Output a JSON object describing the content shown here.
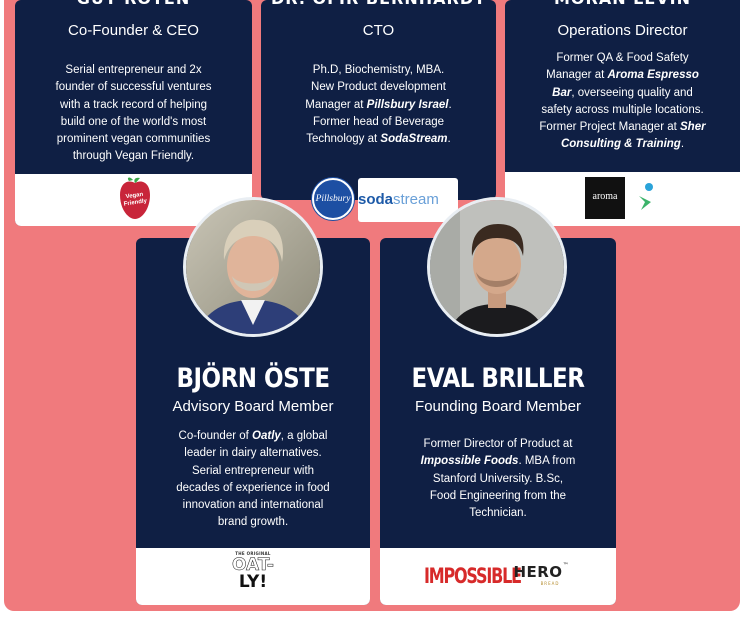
{
  "top_cards": [
    {
      "name": "GUY ROTEN",
      "role": "Co-Founder & CEO",
      "bio": [
        "Serial entrepreneur and 2x",
        "founder of successful ventures",
        "with a track record of helping",
        "build one of the world's most",
        "prominent vegan communities",
        "through Vegan Friendly."
      ],
      "logo": {
        "line1": "Vegan",
        "line2": "Friendly"
      }
    },
    {
      "name": "DR. OFIR BERNHARDT",
      "role": "CTO",
      "bio_plain1": "Ph.D, Biochemistry, MBA.",
      "bio_plain2": "New Product development",
      "bio_plain3": "Manager at ",
      "bio_em1": "Pillsbury Israel",
      "bio_plain4": ".",
      "bio_plain5": "Former head of Beverage",
      "bio_plain6": "Technology at ",
      "bio_em2": "SodaStream",
      "bio_plain7": ".",
      "logos": {
        "pillsbury": "Pillsbury",
        "soda": "soda",
        "stream": "stream"
      }
    },
    {
      "name": "MORAN LEVIN",
      "role": "Operations Director",
      "bio_l1": "Former QA & Food Safety",
      "bio_l2a": "Manager at ",
      "bio_l2b": "Aroma Espresso",
      "bio_l3a": "Bar",
      "bio_l3b": ", overseeing quality and",
      "bio_l4": "safety across multiple locations.",
      "bio_l5a": "Former Project Manager at ",
      "bio_l5b": "Sher",
      "bio_l6": "Consulting & Training",
      "bio_l6b": ".",
      "logos": {
        "aroma": "aroma"
      }
    }
  ],
  "bottom_cards": [
    {
      "name": "BJÖRN ÖSTE",
      "role": "Advisory Board Member",
      "bio_l1a": "Co-founder of ",
      "bio_l1b": "Oatly",
      "bio_l1c": ", a global",
      "bio_l2": "leader in dairy alternatives.",
      "bio_l3": "Serial entrepreneur with",
      "bio_l4": "decades of experience in food",
      "bio_l5": "innovation and international",
      "bio_l6": "brand growth.",
      "logo": {
        "top": "THE ORIGINAL",
        "mid": "OAT-",
        "bot": "LY!"
      }
    },
    {
      "name": "EVAL BRILLER",
      "role": "Founding Board Member",
      "bio_l1": "Former Director of Product at",
      "bio_l2a": "Impossible Foods",
      "bio_l2b": ". MBA from",
      "bio_l3": "Stanford University. B.Sc,",
      "bio_l4": "Food Engineering from the",
      "bio_l5": "Technician.",
      "logos": {
        "impossible": "IMPOSSIBLE",
        "hero": "HERO",
        "hero_tm": "™",
        "hero_sub": "BREAD"
      }
    }
  ],
  "colors": {
    "background": "#f07a7d",
    "card": "#0f1f44",
    "foot": "#ffffff"
  }
}
